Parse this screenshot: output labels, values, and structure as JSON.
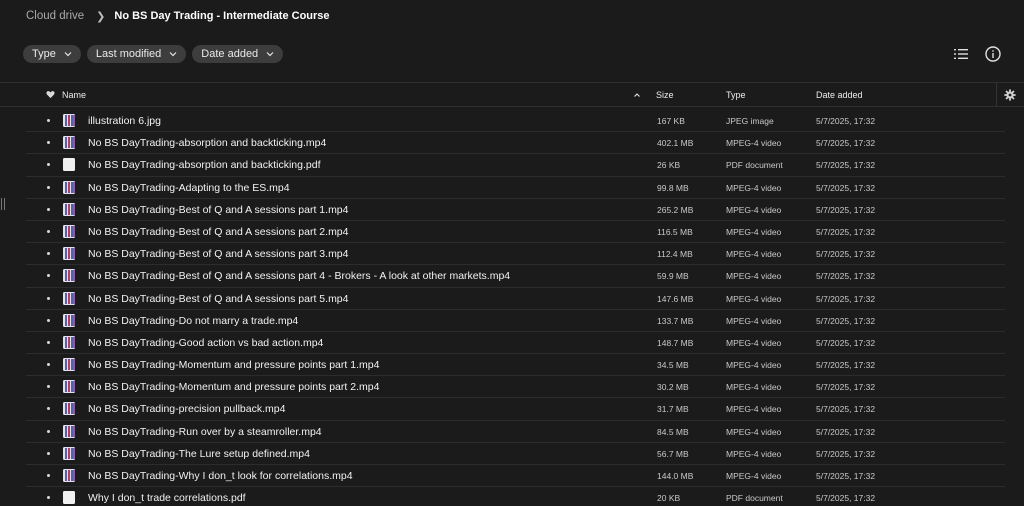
{
  "breadcrumb": {
    "root": "Cloud drive",
    "current": "No BS Day Trading - Intermediate Course"
  },
  "filters": [
    {
      "label": "Type",
      "icon": "chevron-down-icon"
    },
    {
      "label": "Last modified",
      "icon": "chevron-down-icon"
    },
    {
      "label": "Date added",
      "icon": "chevron-down-icon"
    }
  ],
  "toolbar": {
    "list_view_icon": "list-view-icon",
    "info_icon": "info-icon"
  },
  "columns": {
    "name": "Name",
    "size": "Size",
    "type": "Type",
    "date_added": "Date added"
  },
  "colors": {
    "background": "#1b1b1b",
    "chip": "#3d3d3d",
    "divider": "#2c2c2c"
  },
  "files": [
    {
      "name": "illustration 6.jpg",
      "size": "167 KB",
      "type": "JPEG image",
      "date_added": "5/7/2025, 17:32",
      "icon": "image-file-icon"
    },
    {
      "name": "No BS DayTrading-absorption and backticking.mp4",
      "size": "402.1 MB",
      "type": "MPEG-4 video",
      "date_added": "5/7/2025, 17:32",
      "icon": "video-file-icon"
    },
    {
      "name": "No BS DayTrading-absorption and backticking.pdf",
      "size": "26 KB",
      "type": "PDF document",
      "date_added": "5/7/2025, 17:32",
      "icon": "pdf-file-icon"
    },
    {
      "name": "No BS DayTrading-Adapting to the ES.mp4",
      "size": "99.8 MB",
      "type": "MPEG-4 video",
      "date_added": "5/7/2025, 17:32",
      "icon": "video-file-icon"
    },
    {
      "name": "No BS DayTrading-Best of Q and A sessions part 1.mp4",
      "size": "265.2 MB",
      "type": "MPEG-4 video",
      "date_added": "5/7/2025, 17:32",
      "icon": "video-file-icon"
    },
    {
      "name": "No BS DayTrading-Best of Q and A sessions part 2.mp4",
      "size": "116.5 MB",
      "type": "MPEG-4 video",
      "date_added": "5/7/2025, 17:32",
      "icon": "video-file-icon"
    },
    {
      "name": "No BS DayTrading-Best of Q and A sessions part 3.mp4",
      "size": "112.4 MB",
      "type": "MPEG-4 video",
      "date_added": "5/7/2025, 17:32",
      "icon": "video-file-icon"
    },
    {
      "name": "No BS DayTrading-Best of Q and A sessions part 4 - Brokers - A look at other markets.mp4",
      "size": "59.9 MB",
      "type": "MPEG-4 video",
      "date_added": "5/7/2025, 17:32",
      "icon": "video-file-icon"
    },
    {
      "name": "No BS DayTrading-Best of Q and A sessions part 5.mp4",
      "size": "147.6 MB",
      "type": "MPEG-4 video",
      "date_added": "5/7/2025, 17:32",
      "icon": "video-file-icon"
    },
    {
      "name": "No BS DayTrading-Do not marry a trade.mp4",
      "size": "133.7 MB",
      "type": "MPEG-4 video",
      "date_added": "5/7/2025, 17:32",
      "icon": "video-file-icon"
    },
    {
      "name": "No BS DayTrading-Good action vs bad action.mp4",
      "size": "148.7 MB",
      "type": "MPEG-4 video",
      "date_added": "5/7/2025, 17:32",
      "icon": "video-file-icon"
    },
    {
      "name": "No BS DayTrading-Momentum and pressure points part 1.mp4",
      "size": "34.5 MB",
      "type": "MPEG-4 video",
      "date_added": "5/7/2025, 17:32",
      "icon": "video-file-icon"
    },
    {
      "name": "No BS DayTrading-Momentum and pressure points part 2.mp4",
      "size": "30.2 MB",
      "type": "MPEG-4 video",
      "date_added": "5/7/2025, 17:32",
      "icon": "video-file-icon"
    },
    {
      "name": "No BS DayTrading-precision pullback.mp4",
      "size": "31.7 MB",
      "type": "MPEG-4 video",
      "date_added": "5/7/2025, 17:32",
      "icon": "video-file-icon"
    },
    {
      "name": "No BS DayTrading-Run over by a steamroller.mp4",
      "size": "84.5 MB",
      "type": "MPEG-4 video",
      "date_added": "5/7/2025, 17:32",
      "icon": "video-file-icon"
    },
    {
      "name": "No BS DayTrading-The Lure setup defined.mp4",
      "size": "56.7 MB",
      "type": "MPEG-4 video",
      "date_added": "5/7/2025, 17:32",
      "icon": "video-file-icon"
    },
    {
      "name": "No BS DayTrading-Why I don_t look for correlations.mp4",
      "size": "144.0 MB",
      "type": "MPEG-4 video",
      "date_added": "5/7/2025, 17:32",
      "icon": "video-file-icon"
    },
    {
      "name": "Why I don_t trade correlations.pdf",
      "size": "20 KB",
      "type": "PDF document",
      "date_added": "5/7/2025, 17:32",
      "icon": "pdf-file-icon"
    }
  ]
}
